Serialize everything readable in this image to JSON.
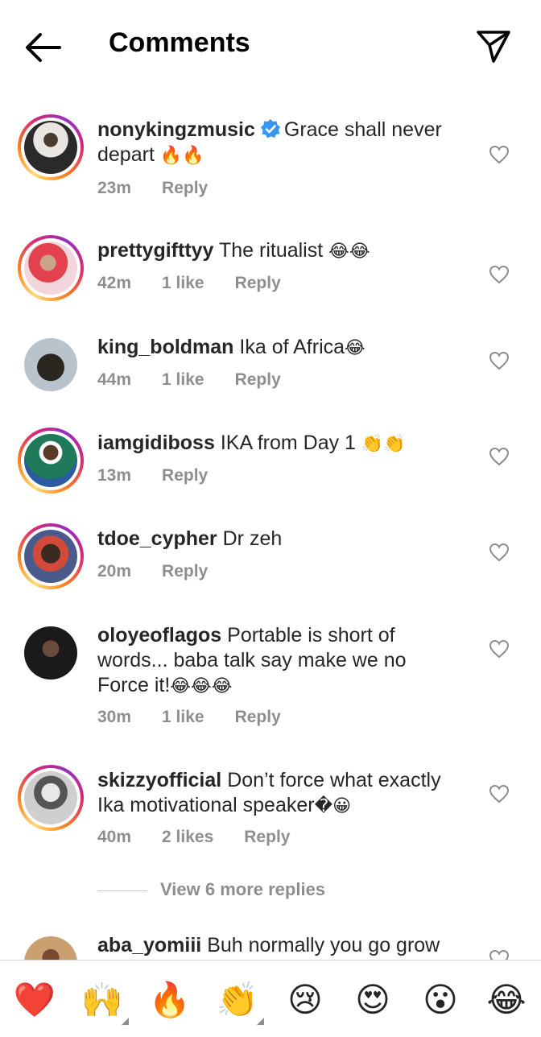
{
  "header": {
    "title": "Comments"
  },
  "comments": [
    {
      "user": "nonykingzmusic",
      "verified": true,
      "text_part1": "Grace shall never",
      "text_part2": "depart ",
      "emoji": "🔥🔥",
      "time": "23m",
      "likes": "",
      "reply": "Reply"
    },
    {
      "user": "prettygifttyy",
      "text": "The ritualist ",
      "emoji": "😂😂",
      "time": "42m",
      "likes": "1 like",
      "reply": "Reply"
    },
    {
      "user": "king_boldman",
      "text": "Ika of Africa",
      "emoji": "😂",
      "time": "44m",
      "likes": "1 like",
      "reply": "Reply"
    },
    {
      "user": "iamgidiboss",
      "text": "IKA from Day 1 ",
      "emoji": "👏👏",
      "time": "13m",
      "likes": "",
      "reply": "Reply"
    },
    {
      "user": "tdoe_cypher",
      "text": "Dr zeh",
      "time": "20m",
      "likes": "",
      "reply": "Reply"
    },
    {
      "user": "oloyeoflagos",
      "text_part1": "Portable is short of",
      "text_part2": "words... baba talk say make we no",
      "text_part3": "Force it!",
      "emoji": "😂😂😂",
      "time": "30m",
      "likes": "1 like",
      "reply": "Reply"
    },
    {
      "user": "skizzyofficial",
      "text_part1": "Don’t force what exactly",
      "text_part2": "Ika motivational speaker",
      "emoji": "�😀",
      "time": "40m",
      "likes": "2 likes",
      "reply": "Reply"
    },
    {
      "user": "aba_yomiii",
      "text": "Buh normally you go grow"
    }
  ],
  "view_more_replies": "View 6 more replies",
  "reactions": [
    "❤️",
    "🙌",
    "🔥",
    "👏",
    "😢",
    "😍",
    "😮",
    "😂"
  ],
  "icons": {
    "back": "back-arrow-icon",
    "send": "paper-plane-icon",
    "like": "heart-outline-icon",
    "verified": "verified-badge-icon"
  },
  "colors": {
    "verified": "#3897f0",
    "muted": "#8e8e8e",
    "text": "#262626"
  }
}
